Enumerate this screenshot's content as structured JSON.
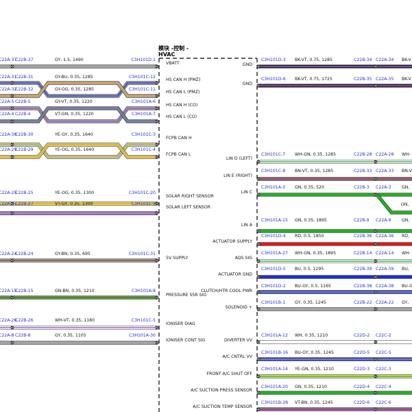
{
  "module": {
    "title_zh": "模块 -控制 -",
    "title_en": "HVAC"
  },
  "left_wires": [
    {
      "c1": "C22A-37",
      "c2": "C22B-37",
      "spec": "GY, 1.5, 1490",
      "pin": "C3H101D-1",
      "pin_label": "VBATT",
      "colors": [
        "#a3a3a3"
      ]
    },
    {
      "c1": "C22A-31",
      "c2": "C22B-31",
      "spec": "GY-BU, 0.35, 1285",
      "pin": "C3H101C-12",
      "pin_label": "HS CAN H (PMZ)",
      "colors": [
        "#a3a3a3",
        "#2b3fd6"
      ],
      "cross": "a"
    },
    {
      "c1": "C22A-32",
      "c2": "C22B-32",
      "spec": "GY-OG, 0.35, 1285",
      "pin": "C3H101C-11",
      "pin_label": "HS CAN L (PMZ)",
      "colors": [
        "#a3a3a3",
        "#f0a020"
      ],
      "cross": "b"
    },
    {
      "c1": "C22A-5",
      "c2": "C22B-5",
      "spec": "GY-VT, 0.35, 1220",
      "pin": "C3H101A-6",
      "pin_label": "HS CAN H (CO)",
      "colors": [
        "#a3a3a3",
        "#9a5bd6"
      ],
      "cross": "a"
    },
    {
      "c1": "C22A-4",
      "c2": "C22B-4",
      "spec": "VT-GN, 0.35, 1220",
      "pin": "C3H101A-7",
      "pin_label": "HS CAN L (CO)",
      "colors": [
        "#9a5bd6",
        "#3cb54a"
      ],
      "cross": "b"
    },
    {
      "c1": "C22A-30",
      "c2": "C22B-30",
      "spec": "YE-GY, 0.35, 1640",
      "pin": "C3H101C-3",
      "pin_label": "FCPB CAN H",
      "colors": [
        "#d9d96a",
        "#a3a3a3"
      ],
      "cross": "a"
    },
    {
      "c1": "C22A-29",
      "c2": "C22B-29",
      "spec": "YE-OG, 0.35, 1640",
      "pin": "C3H101C-4",
      "pin_label": "FCPB CAN L",
      "colors": [
        "#d9d96a",
        "#f0a020"
      ],
      "cross": "b"
    },
    {
      "c1": "C22A-25",
      "c2": "C22B-25",
      "spec": "YE-OG, 0.35, 1300",
      "pin": "C3H101C-20",
      "pin_label": "SOLAR RIGHT SENSOR",
      "colors": [
        "#e6e64a",
        "#f0a020"
      ]
    },
    {
      "c1": "C22A-27",
      "c2": "C22B-27",
      "spec": "VT-GY, 0.35, 1300",
      "pin": "C3H101C-9",
      "pin_label": "SOLAR LEFT SENSOR",
      "colors": [
        "#9a5bd6",
        "#a3a3a3"
      ]
    },
    {
      "c1": "C22A-24",
      "c2": "C22B-24",
      "spec": "GY-BN, 0.35, 695",
      "pin": "C3H101C-31",
      "pin_label": "5V SUPPLY",
      "colors": [
        "#a3a3a3",
        "#8a5a2a"
      ]
    },
    {
      "c1": "C22A-15",
      "c2": "C22B-15",
      "spec": "GN-BN, 0.35, 1210",
      "pin": "C3H101A-8",
      "pin_label": "PRESSURE SSR SIG",
      "colors": [
        "#3cb54a",
        "#8a5a2a"
      ]
    },
    {
      "c1": "C22A-26",
      "c2": "C22B-26",
      "spec": "WH-VT, 0.35, 1180",
      "pin": "C3H101C-5",
      "pin_label": "IONISER DIAG",
      "colors": [
        "#ffffff",
        "#9a5bd6"
      ]
    },
    {
      "c1": "C22A-8",
      "c2": "C22B-8",
      "spec": "GY, 0.35, 1105",
      "pin": "C3H101A-30",
      "pin_label": "IONISER CONT SIG",
      "colors": [
        "#a3a3a3"
      ]
    }
  ],
  "right_wires": [
    {
      "pin_label": "GND",
      "pin": "C3H101D-3",
      "spec": "BK-VT, 0.75, 1285",
      "c2": "C22B-34",
      "c1": "C22A-34",
      "cut": "BK-V",
      "colors": [
        "#222222",
        "#9a5bd6"
      ]
    },
    {
      "pin_label": "GND",
      "pin": "C3H101D-6",
      "spec": "BK-VT, 0.75, 1725",
      "c2": "C22B-35",
      "c1": "C22A-35",
      "cut": "BK-V",
      "colors": [
        "#222222",
        "#9a5bd6"
      ]
    },
    {
      "pin_label": "LIN D (LEFT)",
      "pin": "C3H101C-7",
      "spec": "WH-GN, 0.35, 1285",
      "c2": "C22B-28",
      "c1": "C22A-28",
      "cut": "WH-",
      "colors": [
        "#ffffff",
        "#3cb54a"
      ]
    },
    {
      "pin_label": "LIN E (RIGHT)",
      "pin": "C3H101C-8",
      "spec": "BN-VT, 0.35, 1285",
      "c2": "C22B-33",
      "c1": "C22A-33",
      "cut": "BN-V",
      "colors": [
        "#8a5a2a",
        "#9a5bd6"
      ]
    },
    {
      "pin_label": "LIN C",
      "pin": "C3H101A-3",
      "spec": "GN, 0.35, 520",
      "c2": "C22B-3",
      "c1": "C22A-3",
      "cut": "GN,",
      "colors": [
        "#22b022"
      ],
      "branch": true
    },
    {
      "pin_label": "LIN A",
      "pin": "C3H101A-15",
      "spec": "GN, 0.35, 1895",
      "c2": "C22B-9",
      "c1": "C22A-9",
      "cut": "GN,",
      "colors": [
        "#22b022"
      ]
    },
    {
      "pin_label": "ACTUATOR SUPPLY",
      "pin": "C3H101D-4",
      "spec": "RD, 0.5, 1850",
      "c2": "C22B-36",
      "c1": "C22A-36",
      "cut": "RD,",
      "colors": [
        "#ee1111"
      ]
    },
    {
      "pin_label": "AQS SIG",
      "pin": "C3H101A-27",
      "spec": "WH-GN, 0.35, 1895",
      "c2": "C22B-14",
      "c1": "C22A-14",
      "cut": "WH-",
      "colors": [
        "#ffffff",
        "#3cb54a"
      ]
    },
    {
      "pin_label": "ACTUATOR GND",
      "pin": "C3H101D-5",
      "spec": "BU, 0.5, 1295",
      "c2": "C22B-39",
      "c1": "C22A-39",
      "cut": "BU,",
      "colors": [
        "#1a2fd0"
      ]
    },
    {
      "pin_label": "CLUTCH/HTR COOL PWR",
      "pin": "C3H101D-2",
      "spec": "BU-GY, 0.5, 1165",
      "c2": "C22B-38",
      "c1": "C22A-38",
      "cut": "BU-G",
      "colors": [
        "#1a2fd0",
        "#a3a3a3"
      ]
    },
    {
      "pin_label": "SOLENOID +",
      "pin": "C3H101B-1",
      "spec": "GY, 0.35, 1245",
      "c2": "C22B-22",
      "c1": "C22A-22",
      "cut": "GY,",
      "colors": [
        "#a3a3a3"
      ]
    },
    {
      "pin_label": "DIVERTER VV",
      "pin": "C3H101A-12",
      "spec": "WH, 0.35, 1210",
      "c2": "C22D-2",
      "c1": "C22C-2",
      "cut": "",
      "colors": [
        "#ffffff"
      ]
    },
    {
      "pin_label": "A/C CNTRL VV",
      "pin": "C3H101B-16",
      "spec": "BU-GY, 0.35, 1245",
      "c2": "C22D-5",
      "c1": "C22C-5",
      "cut": "",
      "colors": [
        "#1a2fd0",
        "#a3a3a3"
      ]
    },
    {
      "pin_label": "FRONT A/C SHUT OFF",
      "pin": "C3H101A-14",
      "spec": "YE-GN, 0.35, 1210",
      "c2": "C22D-3",
      "c1": "C22C-3",
      "cut": "",
      "colors": [
        "#e6e64a",
        "#3cb54a"
      ]
    },
    {
      "pin_label": "A/C SUCTION PRESS SENSOR",
      "pin": "C3H101A-20",
      "spec": "GN, 0.35, 1210",
      "c2": "C22D-4",
      "c1": "C22C-4",
      "cut": "",
      "colors": [
        "#22b022"
      ]
    },
    {
      "pin_label": "A/C SUCTION TEMP SENSOR",
      "pin": "C3H101B-28",
      "spec": "VT-BN, 0.35, 1245",
      "c2": "C22D-6",
      "c1": "C22C-6",
      "cut": "",
      "colors": [
        "#9a5bd6",
        "#8a5a2a"
      ]
    }
  ]
}
